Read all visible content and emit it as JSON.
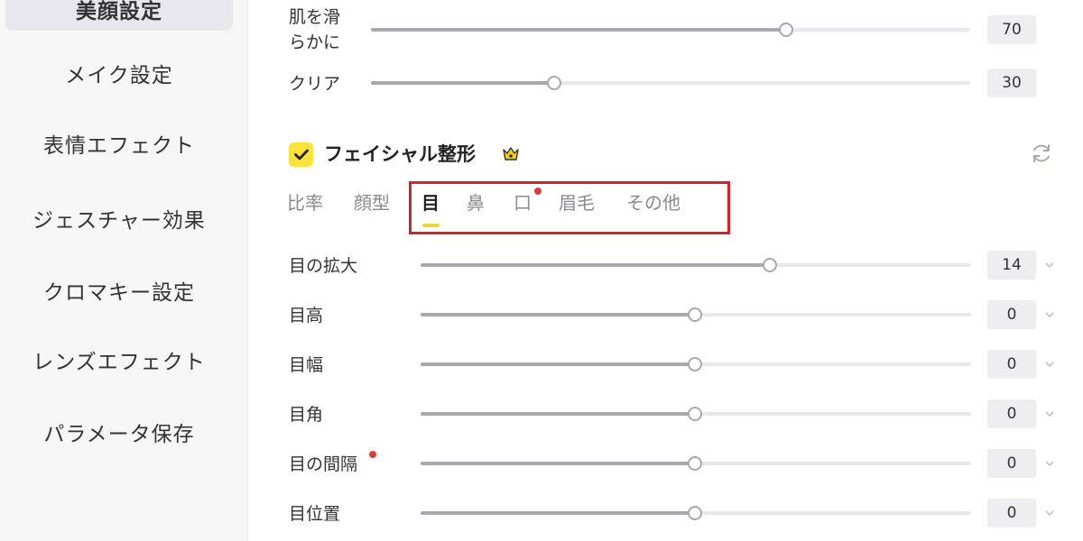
{
  "sidebar": {
    "items": [
      {
        "label": "美顔設定",
        "active": true
      },
      {
        "label": "メイク設定"
      },
      {
        "label": "表情エフェクト"
      },
      {
        "label": "ジェスチャー効果"
      },
      {
        "label": "クロマキー設定"
      },
      {
        "label": "レンズエフェクト"
      },
      {
        "label": "パラメータ保存"
      }
    ]
  },
  "beauty": {
    "smooth": {
      "label_line1": "肌を滑",
      "label_line2": "らかに",
      "value": "70"
    },
    "clear": {
      "label": "クリア",
      "value": "30"
    }
  },
  "facial": {
    "title": "フェイシャル整形",
    "checked": true,
    "icons": {
      "premium": "crown-icon",
      "reset": "reset-icon"
    },
    "tabs": [
      {
        "label": "比率"
      },
      {
        "label": "顔型"
      },
      {
        "label": "目",
        "active": true
      },
      {
        "label": "鼻"
      },
      {
        "label": "口",
        "new": true
      },
      {
        "label": "眉毛"
      },
      {
        "label": "その他"
      }
    ],
    "sliders": [
      {
        "label": "目の拡大",
        "value": "14"
      },
      {
        "label": "目高",
        "value": "0"
      },
      {
        "label": "目幅",
        "value": "0"
      },
      {
        "label": "目角",
        "value": "0"
      },
      {
        "label": "目の間隔",
        "value": "0",
        "new": true
      },
      {
        "label": "目位置",
        "value": "0"
      }
    ]
  },
  "colors": {
    "accent_yellow": "#fde23a",
    "highlight_red": "#d2232a",
    "badge_red": "#e03a3a",
    "slider_fill": "#a8a8b0",
    "slider_track": "#e8e8ec"
  }
}
